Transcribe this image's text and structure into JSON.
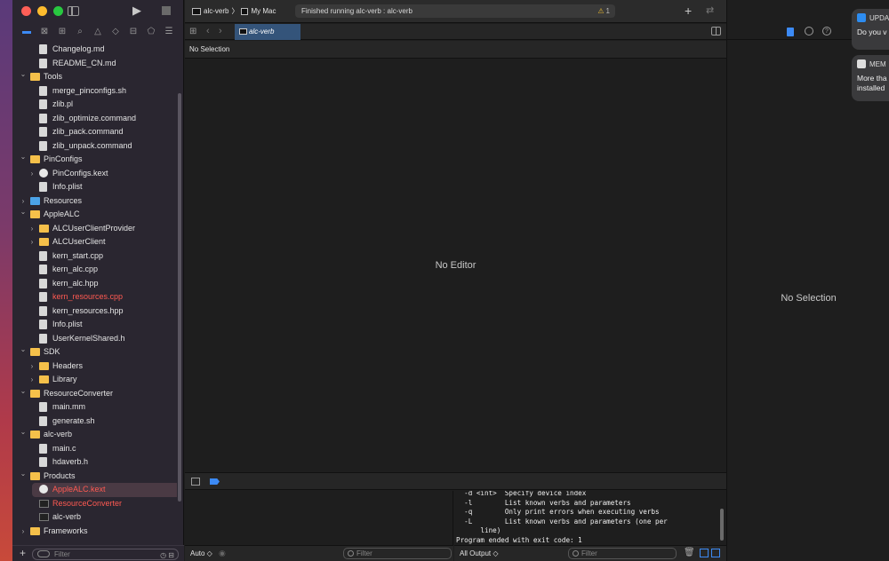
{
  "window": {
    "scheme": "alc-verb",
    "destination": "My Mac",
    "status": "Finished running alc-verb : alc-verb",
    "warning_count": "1"
  },
  "navigator": {
    "filter_placeholder": "Filter",
    "rows": [
      {
        "label": "Changelog.md",
        "indent": 2,
        "icon": "file",
        "chev": ""
      },
      {
        "label": "README_CN.md",
        "indent": 2,
        "icon": "file",
        "chev": ""
      },
      {
        "label": "Tools",
        "indent": 1,
        "icon": "folder",
        "chev": "v"
      },
      {
        "label": "merge_pinconfigs.sh",
        "indent": 2,
        "icon": "file",
        "chev": ""
      },
      {
        "label": "zlib.pl",
        "indent": 2,
        "icon": "file",
        "chev": ""
      },
      {
        "label": "zlib_optimize.command",
        "indent": 2,
        "icon": "file",
        "chev": ""
      },
      {
        "label": "zlib_pack.command",
        "indent": 2,
        "icon": "file",
        "chev": ""
      },
      {
        "label": "zlib_unpack.command",
        "indent": 2,
        "icon": "file",
        "chev": ""
      },
      {
        "label": "PinConfigs",
        "indent": 1,
        "icon": "folder",
        "chev": "v"
      },
      {
        "label": "PinConfigs.kext",
        "indent": 2,
        "icon": "kext",
        "chev": ">"
      },
      {
        "label": "Info.plist",
        "indent": 2,
        "icon": "file",
        "chev": ""
      },
      {
        "label": "Resources",
        "indent": 1,
        "icon": "folder-blue",
        "chev": ">"
      },
      {
        "label": "AppleALC",
        "indent": 1,
        "icon": "folder",
        "chev": "v"
      },
      {
        "label": "ALCUserClientProvider",
        "indent": 2,
        "icon": "folder",
        "chev": ">"
      },
      {
        "label": "ALCUserClient",
        "indent": 2,
        "icon": "folder",
        "chev": ">"
      },
      {
        "label": "kern_start.cpp",
        "indent": 2,
        "icon": "file",
        "chev": ""
      },
      {
        "label": "kern_alc.cpp",
        "indent": 2,
        "icon": "file",
        "chev": ""
      },
      {
        "label": "kern_alc.hpp",
        "indent": 2,
        "icon": "file",
        "chev": ""
      },
      {
        "label": "kern_resources.cpp",
        "indent": 2,
        "icon": "file",
        "chev": "",
        "red": true
      },
      {
        "label": "kern_resources.hpp",
        "indent": 2,
        "icon": "file",
        "chev": ""
      },
      {
        "label": "Info.plist",
        "indent": 2,
        "icon": "file",
        "chev": ""
      },
      {
        "label": "UserKernelShared.h",
        "indent": 2,
        "icon": "file",
        "chev": ""
      },
      {
        "label": "SDK",
        "indent": 1,
        "icon": "folder",
        "chev": "v"
      },
      {
        "label": "Headers",
        "indent": 2,
        "icon": "folder",
        "chev": ">"
      },
      {
        "label": "Library",
        "indent": 2,
        "icon": "folder",
        "chev": ">"
      },
      {
        "label": "ResourceConverter",
        "indent": 1,
        "icon": "folder",
        "chev": "v"
      },
      {
        "label": "main.mm",
        "indent": 2,
        "icon": "file",
        "chev": ""
      },
      {
        "label": "generate.sh",
        "indent": 2,
        "icon": "file",
        "chev": ""
      },
      {
        "label": "alc-verb",
        "indent": 1,
        "icon": "folder",
        "chev": "v"
      },
      {
        "label": "main.c",
        "indent": 2,
        "icon": "file",
        "chev": ""
      },
      {
        "label": "hdaverb.h",
        "indent": 2,
        "icon": "file",
        "chev": ""
      },
      {
        "label": "Products",
        "indent": 1,
        "icon": "folder",
        "chev": "v"
      },
      {
        "label": "AppleALC.kext",
        "indent": 2,
        "icon": "kext",
        "chev": "",
        "red": true,
        "selected": true
      },
      {
        "label": "ResourceConverter",
        "indent": 2,
        "icon": "app",
        "chev": "",
        "red": true
      },
      {
        "label": "alc-verb",
        "indent": 2,
        "icon": "app",
        "chev": ""
      },
      {
        "label": "Frameworks",
        "indent": 1,
        "icon": "folder",
        "chev": ">"
      }
    ]
  },
  "editor": {
    "tab_label": "alc-verb",
    "jump_bar": "No Selection",
    "placeholder": "No Editor"
  },
  "debug": {
    "variables_scope": "Auto ◇",
    "variables_filter": "Filter",
    "console_scope": "All Output ◇",
    "console_filter": "Filter",
    "console_lines": "  -d <int>  Specify device index\n  -l        List known verbs and parameters\n  -q        Only print errors when executing verbs\n  -L        List known verbs and parameters (one per\n      line)\nProgram ended with exit code: 1"
  },
  "inspector": {
    "placeholder": "No Selection"
  },
  "notifications": [
    {
      "title": "UPDA",
      "body": "Do you v"
    },
    {
      "title": "MEM",
      "body": "More tha\ninstalled"
    }
  ],
  "colors": {
    "accent": "#3c8af5",
    "error_red": "#ff5a52",
    "folder_yellow": "#f5c04a"
  }
}
